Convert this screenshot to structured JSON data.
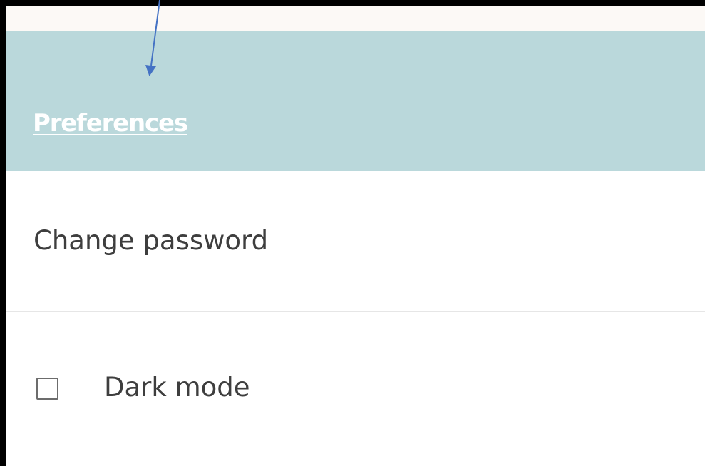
{
  "header": {
    "link_label": "Preferences"
  },
  "menu": {
    "change_password_label": "Change password"
  },
  "settings": {
    "dark_mode_label": "Dark mode",
    "dark_mode_checked": false
  },
  "colors": {
    "header_background": "#bad8db",
    "annotation_arrow": "#4472c4",
    "frame_border": "#000000",
    "text": "#3e3e3e"
  },
  "icons": {
    "annotation": "annotation-arrow-icon",
    "checkbox": "checkbox-unchecked-icon"
  }
}
